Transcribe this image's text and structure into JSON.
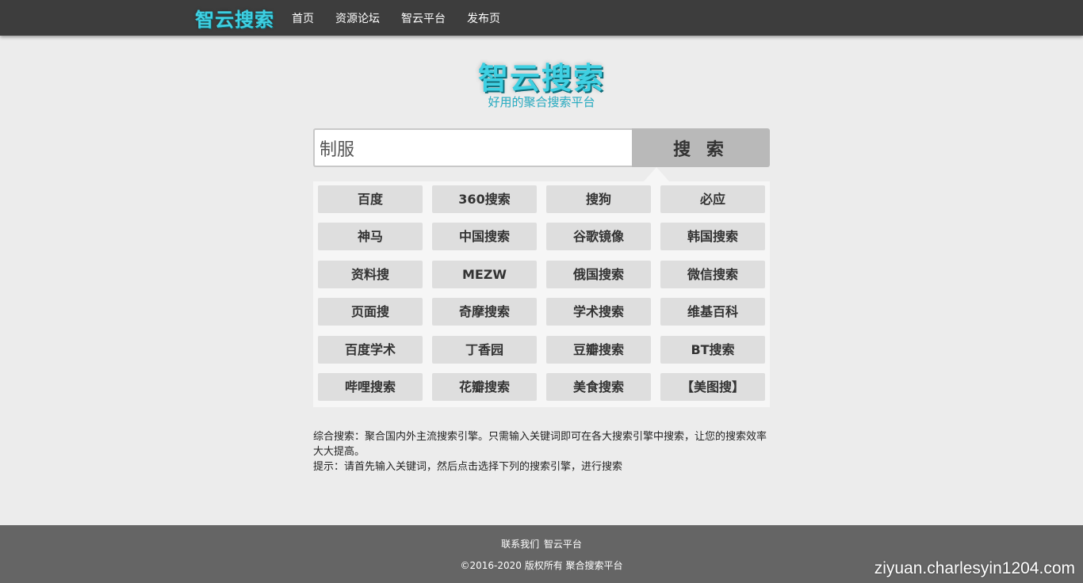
{
  "header": {
    "brand": "智云搜索",
    "nav": [
      "首页",
      "资源论坛",
      "智云平台",
      "发布页"
    ]
  },
  "logo": {
    "title": "智云搜索",
    "subtitle": "好用的聚合搜索平台"
  },
  "search": {
    "value": "制服",
    "button_label": "搜 索"
  },
  "engines": [
    "百度",
    "360搜索",
    "搜狗",
    "必应",
    "神马",
    "中国搜索",
    "谷歌镜像",
    "韩国搜索",
    "资料搜",
    "MEZW",
    "俄国搜索",
    "微信搜索",
    "页面搜",
    "奇摩搜索",
    "学术搜索",
    "维基百科",
    "百度学术",
    "丁香园",
    "豆瓣搜索",
    "BT搜索",
    "哔哩搜索",
    "花瓣搜索",
    "美食搜索",
    "【美图搜】"
  ],
  "description": {
    "line1": "综合搜索：聚合国内外主流搜索引擎。只需输入关键词即可在各大搜索引擎中搜索，让您的搜索效率大大提高。",
    "line2": "提示：请首先输入关键词，然后点击选择下列的搜索引擎，进行搜索"
  },
  "footer": {
    "contact": "联系我们",
    "platform": "智云平台",
    "copyright": "©2016-2020 版权所有 聚合搜索平台"
  },
  "watermark": "ziyuan.charlesyin1204.com",
  "colors": {
    "brand": "#3fd0e2",
    "topbar": "#3d3d3d",
    "footer": "#656565"
  }
}
